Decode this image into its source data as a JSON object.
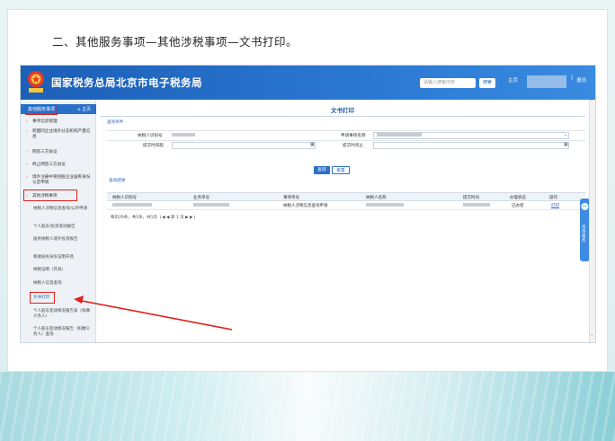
{
  "heading": "二、其他服务事项—其他涉税事项—文书打印。",
  "header": {
    "title": "国家税务总局北京市电子税务局",
    "search_placeholder": "请输入搜索内容",
    "search_button": "搜索",
    "home": "主页",
    "logout": "退出"
  },
  "sidebar": {
    "head_label": "其他服务事项",
    "head_home": "主页",
    "items": [
      "事项信息管理",
      "跨国同企业境外分支机构产量信息",
      "网签三方协议",
      "终止网签三方协议",
      "境外注册中资控股企业居民身份认定申请",
      "其他涉税事项"
    ],
    "subitems": [
      "纳税人涉税信息查询/公开申请",
      "个人股东/投资变动报告",
      "居民纳税人境外投资报告",
      "税收居民身份证明开具",
      "纳税证明（开具）",
      "纳税人信息查询",
      "文书打印",
      "个人股东变动情况报告表（扣缴义务人）",
      "个人股东变动情况报告（扣缴义务人）查询"
    ]
  },
  "main": {
    "panel_title": "文书打印",
    "filter_tab": "查询条件",
    "form": {
      "taxpayer_id_label": "纳税人识别号",
      "doc_name_label": "申请事项名称",
      "submit_from_label": "提交时间起",
      "submit_to_label": "提交时间止"
    },
    "buttons": {
      "query": "查询",
      "reset": "重置"
    },
    "result_tab": "查询结果",
    "columns": [
      "纳税人识别号",
      "业务单号",
      "事项单号",
      "纳税人名称",
      "提交时间",
      "办理状态",
      "操作"
    ],
    "row": {
      "item": "纳税人涉税信息查询申请",
      "status": "已办结",
      "action": "打印"
    },
    "pager": "每页20条，共1条，共1页    ❘◀  ◀  第  1  页  ▶  ▶❘"
  },
  "right_widget": "咨询服务",
  "colors": {
    "header_blue": "#1c5fb6",
    "highlight_red": "#e0201a",
    "link_blue": "#2a67b8"
  }
}
